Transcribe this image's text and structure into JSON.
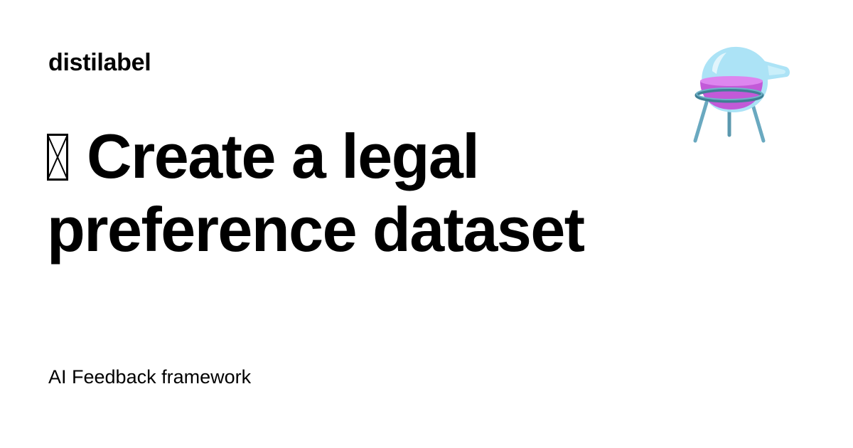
{
  "card": {
    "site_name": "distilabel",
    "headline_icon": "missing-glyph-icon",
    "headline": "Create a legal preference dataset",
    "tagline": "AI Feedback framework",
    "logo_icon": "flask-on-stand-icon"
  },
  "colors": {
    "text": "#000000",
    "background": "#ffffff",
    "flask_glass": "#9ddcf5",
    "flask_liquid": "#c95be0",
    "stand": "#4f8fa8"
  }
}
